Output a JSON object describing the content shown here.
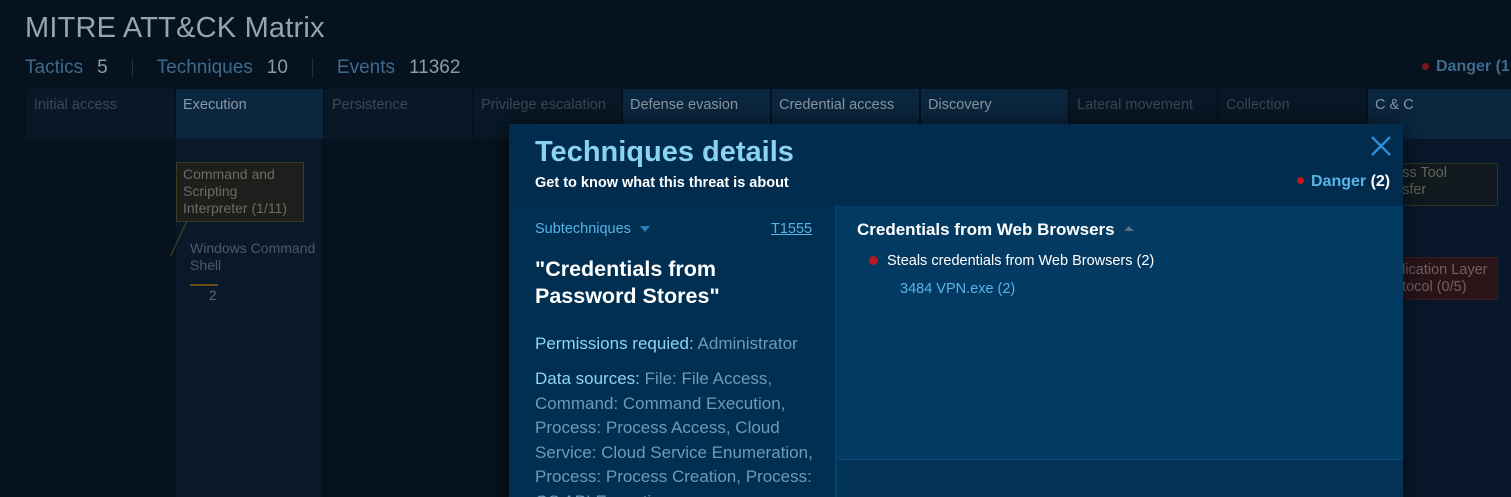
{
  "page": {
    "title": "MITRE ATT&CK Matrix",
    "stats": [
      {
        "label": "Tactics",
        "value": "5"
      },
      {
        "label": "Techniques",
        "value": "10"
      },
      {
        "label": "Events",
        "value": "11362"
      }
    ],
    "danger_label": "Danger (1"
  },
  "tactics": [
    "Initial access",
    "Execution",
    "Persistence",
    "Privilege escalation",
    "Defense evasion",
    "Credential access",
    "Discovery",
    "Lateral movement",
    "Collection",
    "C & C"
  ],
  "background_cards": {
    "execution_technique": "Command and Scripting Interpreter (1/11)",
    "execution_subtechnique": "Windows Command Shell",
    "execution_subtechnique_count": "2",
    "cc_technique_1": "ess Tool\nnsfer",
    "cc_technique_2": "plication Layer\notocol (0/5)"
  },
  "modal": {
    "title": "Techniques details",
    "subtitle": "Get to know what this threat is about",
    "danger_label": "Danger",
    "danger_count": "(2)",
    "subtechniques_label": "Subtechniques",
    "technique_id": "T1555",
    "technique_name": "\"Credentials from Password Stores\"",
    "permissions_label": "Permissions requied:",
    "permissions_value": "Administrator",
    "data_sources_label": "Data sources:",
    "data_sources_value": "File: File Access, Command: Command Execution, Process: Process Access, Cloud Service: Cloud Service Enumeration, Process: Process Creation, Process: OS API Execution",
    "detail_title": "Credentials from Web Browsers",
    "behavior": "Steals credentials from Web Browsers (2)",
    "process": "3484 VPN.exe (2)"
  },
  "colors": {
    "accent": "#58b3e6",
    "danger": "#c4161c",
    "modal_bg": "#023558",
    "page_bg": "#06121d"
  }
}
